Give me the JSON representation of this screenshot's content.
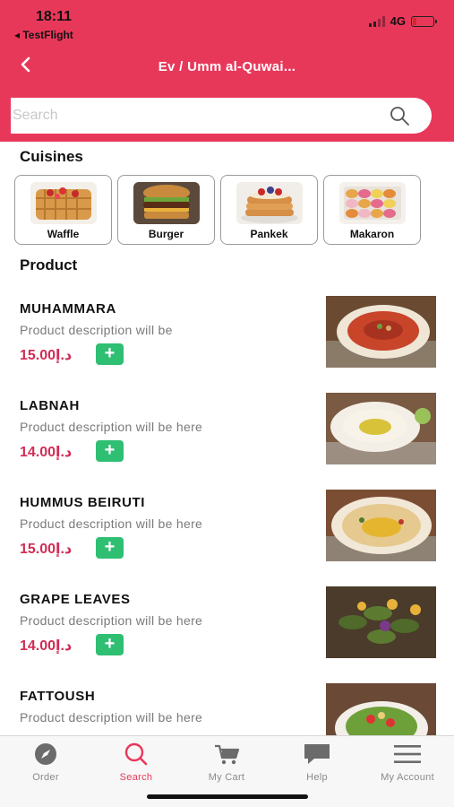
{
  "status_bar": {
    "time": "18:11",
    "back_app": "◂ TestFlight",
    "network": "4G",
    "battery_level": 0.2
  },
  "header": {
    "title": "Ev / Umm al-Quwai...",
    "back_icon": "chevron-left-icon"
  },
  "search": {
    "placeholder": "Search",
    "icon": "search-icon"
  },
  "cuisines": {
    "title": "Cuisines",
    "items": [
      {
        "label": "Waffle"
      },
      {
        "label": "Burger"
      },
      {
        "label": "Pankek"
      },
      {
        "label": "Makaron"
      }
    ]
  },
  "products": {
    "title": "Product",
    "items": [
      {
        "name": "MUHAMMARA",
        "description": "Product description will be",
        "price": "15.00د.إ",
        "add_label": "+"
      },
      {
        "name": "LABNAH",
        "description": "Product description will be here",
        "price": "14.00د.إ",
        "add_label": "+"
      },
      {
        "name": "HUMMUS BEIRUTI",
        "description": "Product description will be here",
        "price": "15.00د.إ",
        "add_label": "+"
      },
      {
        "name": "GRAPE LEAVES",
        "description": "Product description will be here",
        "price": "14.00د.إ",
        "add_label": "+"
      },
      {
        "name": "FATTOUSH",
        "description": "Product description will be here",
        "price": "",
        "add_label": "+"
      }
    ]
  },
  "tabbar": {
    "items": [
      {
        "label": "Order",
        "icon": "compass-icon",
        "active": false
      },
      {
        "label": "Search",
        "icon": "search-icon",
        "active": true
      },
      {
        "label": "My Cart",
        "icon": "cart-icon",
        "active": false
      },
      {
        "label": "Help",
        "icon": "chat-bubble-icon",
        "active": false
      },
      {
        "label": "My Account",
        "icon": "menu-icon",
        "active": false
      }
    ]
  },
  "colors": {
    "brand": "#e8385a",
    "price": "#d12c54",
    "add_button": "#2fbf72"
  }
}
